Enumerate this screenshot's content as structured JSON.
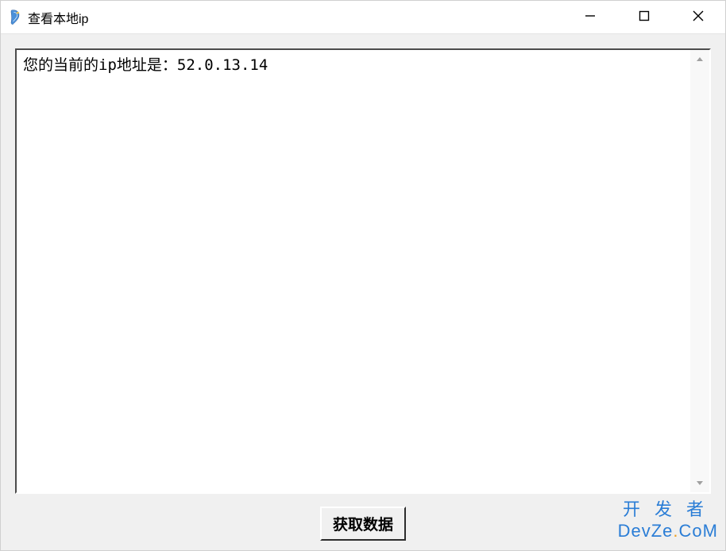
{
  "window": {
    "title": "查看本地ip"
  },
  "textbox": {
    "content": "您的当前的ip地址是：52.0.13.14"
  },
  "button": {
    "fetch_label": "获取数据"
  },
  "watermark": {
    "cn": "开发者",
    "en_prefix": "DevZe",
    "en_suffix": "CoM",
    "dot": "."
  }
}
